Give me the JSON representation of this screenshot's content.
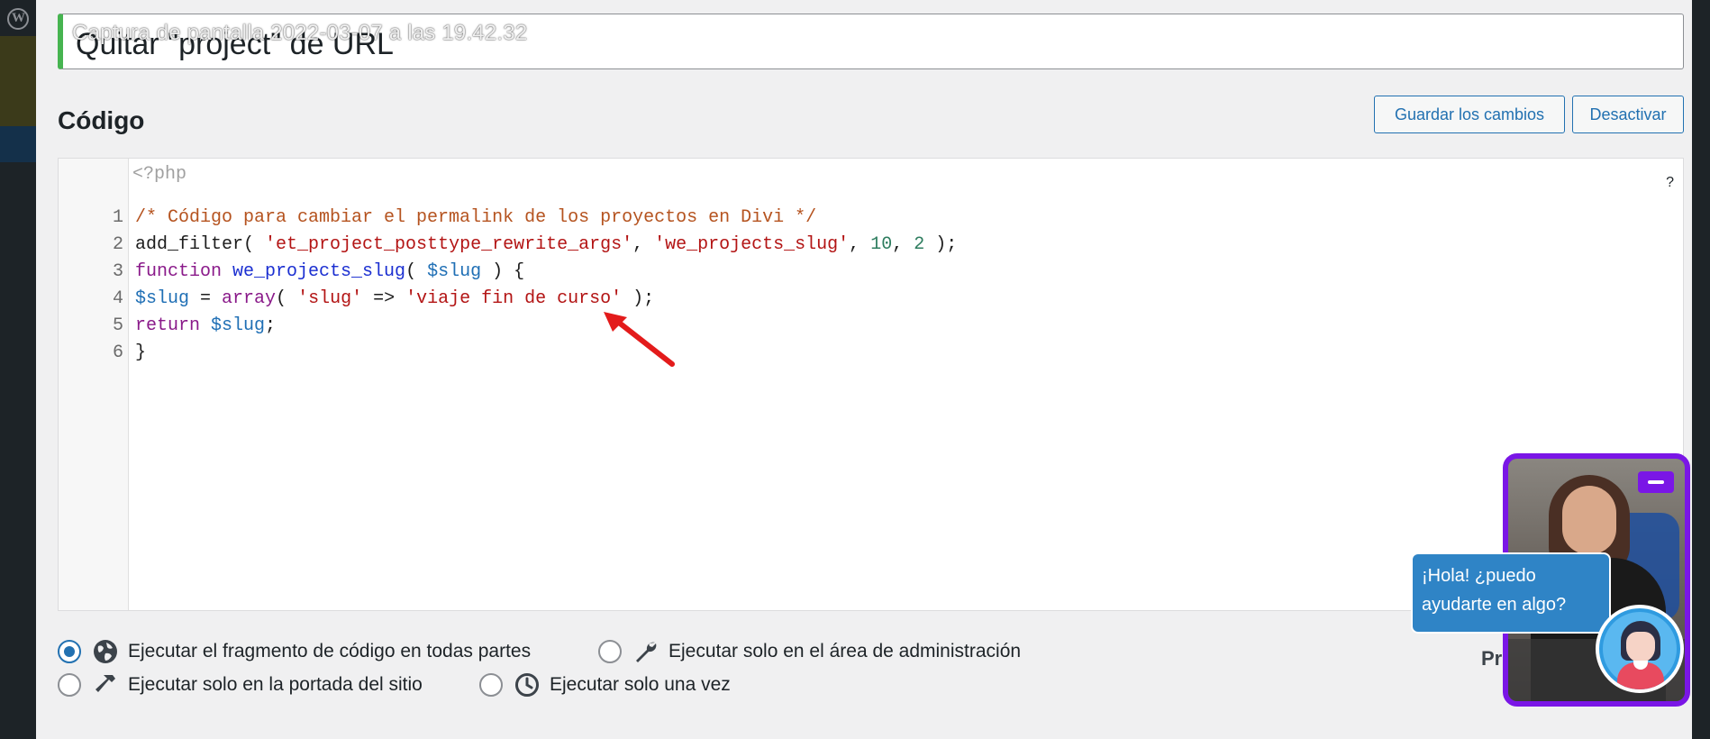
{
  "title_field": {
    "value": "Quitar \"project\" de URL",
    "overlay_label": "Captura de pantalla 2022-03-07 a las 19.42.32"
  },
  "section": {
    "heading": "Código"
  },
  "toolbar": {
    "save_label": "Guardar los cambios",
    "deactivate_label": "Desactivar"
  },
  "editor": {
    "php_open_tag": "<?php",
    "help": "?",
    "lines": [
      {
        "n": "1",
        "tokens": [
          {
            "t": "/* Código para cambiar el permalink de los proyectos en Divi */",
            "c": "c-comment"
          }
        ]
      },
      {
        "n": "2",
        "tokens": [
          {
            "t": "add_filter( ",
            "c": "c-plain"
          },
          {
            "t": "'et_project_posttype_rewrite_args'",
            "c": "c-str"
          },
          {
            "t": ", ",
            "c": "c-plain"
          },
          {
            "t": "'we_projects_slug'",
            "c": "c-str"
          },
          {
            "t": ", ",
            "c": "c-plain"
          },
          {
            "t": "10",
            "c": "c-num"
          },
          {
            "t": ", ",
            "c": "c-plain"
          },
          {
            "t": "2",
            "c": "c-num"
          },
          {
            "t": " );",
            "c": "c-plain"
          }
        ]
      },
      {
        "n": "3",
        "tokens": [
          {
            "t": "function",
            "c": "c-kw"
          },
          {
            "t": " ",
            "c": "c-plain"
          },
          {
            "t": "we_projects_slug",
            "c": "c-fn"
          },
          {
            "t": "( ",
            "c": "c-plain"
          },
          {
            "t": "$slug",
            "c": "c-var"
          },
          {
            "t": " ) {",
            "c": "c-plain"
          }
        ]
      },
      {
        "n": "4",
        "tokens": [
          {
            "t": "$slug",
            "c": "c-var"
          },
          {
            "t": " = ",
            "c": "c-plain"
          },
          {
            "t": "array",
            "c": "c-kw"
          },
          {
            "t": "( ",
            "c": "c-plain"
          },
          {
            "t": "'slug'",
            "c": "c-str"
          },
          {
            "t": " => ",
            "c": "c-plain"
          },
          {
            "t": "'viaje fin de curso'",
            "c": "c-str"
          },
          {
            "t": " );",
            "c": "c-plain"
          }
        ]
      },
      {
        "n": "5",
        "tokens": [
          {
            "t": "return",
            "c": "c-kw"
          },
          {
            "t": " ",
            "c": "c-plain"
          },
          {
            "t": "$slug",
            "c": "c-var"
          },
          {
            "t": ";",
            "c": "c-plain"
          }
        ]
      },
      {
        "n": "6",
        "tokens": [
          {
            "t": "}",
            "c": "c-plain"
          }
        ]
      }
    ]
  },
  "run_options": {
    "everywhere": {
      "label": "Ejecutar el fragmento de código en todas partes",
      "icon": "globe-icon",
      "checked": true
    },
    "admin": {
      "label": "Ejecutar solo en el área de administración",
      "icon": "wrench-icon",
      "checked": false
    },
    "frontend": {
      "label": "Ejecutar solo en la portada del sitio",
      "icon": "hammer-icon",
      "checked": false
    },
    "once": {
      "label": "Ejecutar solo una vez",
      "icon": "clock-icon",
      "checked": false
    }
  },
  "priority": {
    "label": "Pr"
  },
  "chat": {
    "bubble_line1": "¡Hola! ¿puedo",
    "bubble_line2": "ayudarte en algo?"
  },
  "colors": {
    "accent": "#2271b1",
    "active_border": "#46b450",
    "widget_border": "#7a16e6",
    "chat_bubble": "#2f84c6",
    "annotation_arrow": "#e31b1b"
  }
}
